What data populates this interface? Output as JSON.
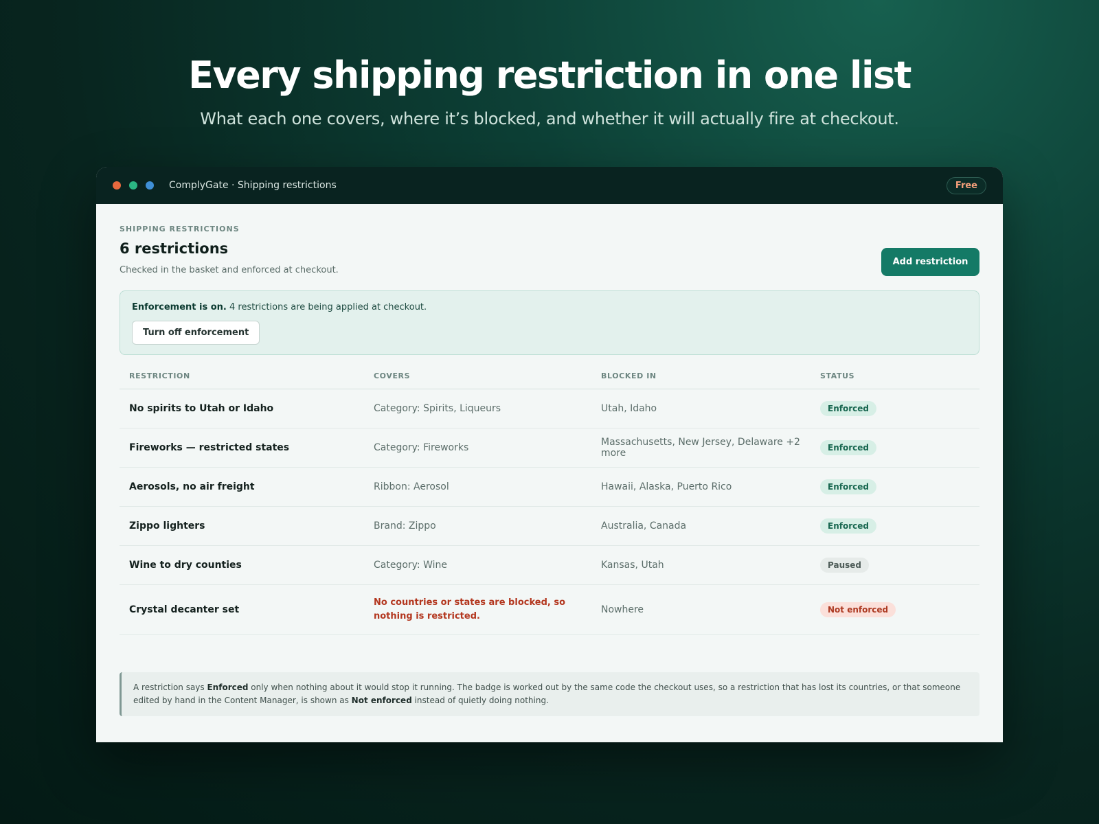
{
  "hero": {
    "title": "Every shipping restriction in one list",
    "subtitle": "What each one covers, where it’s blocked, and whether it will actually fire at checkout."
  },
  "window": {
    "title": "ComplyGate · Shipping restrictions",
    "plan_badge": "Free"
  },
  "page": {
    "eyebrow": "SHIPPING RESTRICTIONS",
    "count_title": "6 restrictions",
    "subtitle": "Checked in the basket and enforced at checkout.",
    "add_button": "Add restriction"
  },
  "banner": {
    "strong": "Enforcement is on.",
    "text": " 4 restrictions are being applied at checkout.",
    "button": "Turn off enforcement"
  },
  "table": {
    "headers": [
      "RESTRICTION",
      "COVERS",
      "BLOCKED IN",
      "STATUS"
    ],
    "rows": [
      {
        "name": "No spirits to Utah or Idaho",
        "covers": "Category: Spirits, Liqueurs",
        "blocked": "Utah, Idaho",
        "status": "Enforced"
      },
      {
        "name": "Fireworks — restricted states",
        "covers": "Category: Fireworks",
        "blocked": "Massachusetts, New Jersey, Delaware +2 more",
        "status": "Enforced"
      },
      {
        "name": "Aerosols, no air freight",
        "covers": "Ribbon: Aerosol",
        "blocked": "Hawaii, Alaska, Puerto Rico",
        "status": "Enforced"
      },
      {
        "name": "Zippo lighters",
        "covers": "Brand: Zippo",
        "blocked": "Australia, Canada",
        "status": "Enforced"
      },
      {
        "name": "Wine to dry counties",
        "covers": "Category: Wine",
        "blocked": "Kansas, Utah",
        "status": "Paused"
      },
      {
        "name": "Crystal decanter set",
        "covers": "No countries or states are blocked, so nothing is restricted.",
        "blocked": "Nowhere",
        "status": "Not enforced"
      }
    ]
  },
  "note": {
    "p1": "A restriction says ",
    "b1": "Enforced",
    "p2": " only when nothing about it would stop it running. The badge is worked out by the same code the checkout uses, so a restriction that has lost its countries, or that someone edited by hand in the Content Manager, is shown as ",
    "b2": "Not enforced",
    "p3": " instead of quietly doing nothing."
  }
}
